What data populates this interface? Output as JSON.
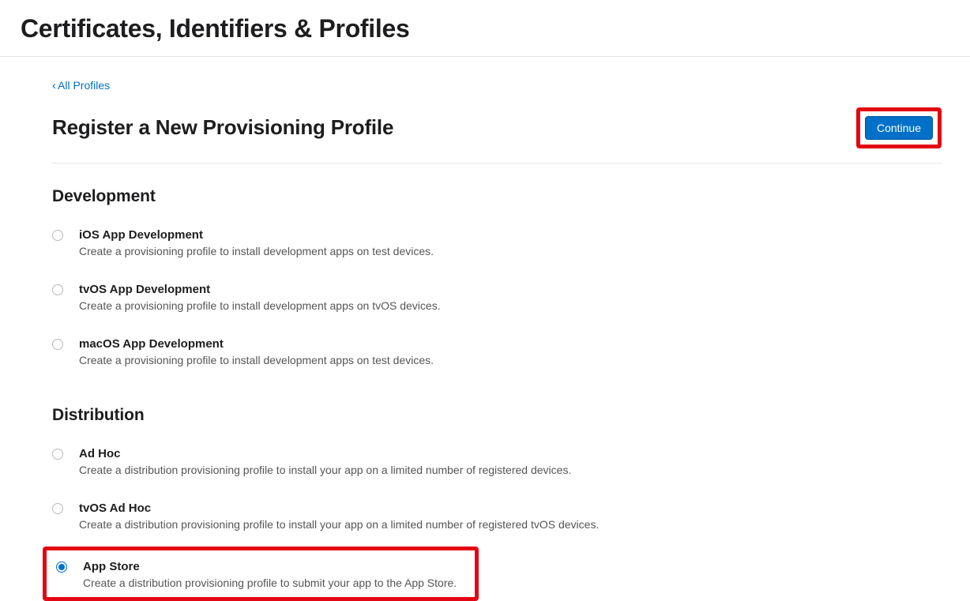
{
  "header": {
    "title": "Certificates, Identifiers & Profiles"
  },
  "nav": {
    "back_link": "All Profiles"
  },
  "subheader": {
    "title": "Register a New Provisioning Profile",
    "continue_label": "Continue"
  },
  "sections": {
    "development": {
      "title": "Development",
      "options": [
        {
          "title": "iOS App Development",
          "desc": "Create a provisioning profile to install development apps on test devices.",
          "selected": false
        },
        {
          "title": "tvOS App Development",
          "desc": "Create a provisioning profile to install development apps on tvOS devices.",
          "selected": false
        },
        {
          "title": "macOS App Development",
          "desc": "Create a provisioning profile to install development apps on test devices.",
          "selected": false
        }
      ]
    },
    "distribution": {
      "title": "Distribution",
      "options": [
        {
          "title": "Ad Hoc",
          "desc": "Create a distribution provisioning profile to install your app on a limited number of registered devices.",
          "selected": false
        },
        {
          "title": "tvOS Ad Hoc",
          "desc": "Create a distribution provisioning profile to install your app on a limited number of registered tvOS devices.",
          "selected": false
        },
        {
          "title": "App Store",
          "desc": "Create a distribution provisioning profile to submit your app to the App Store.",
          "selected": true
        }
      ]
    }
  }
}
